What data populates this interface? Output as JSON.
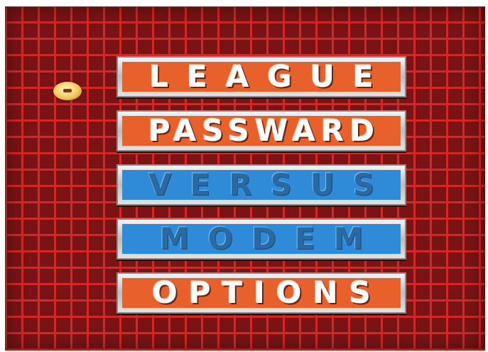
{
  "menu": {
    "items": [
      {
        "label": "LEAGUE",
        "state": "enabled",
        "color": "#e8602a"
      },
      {
        "label": "PASSWARD",
        "state": "enabled",
        "color": "#e8602a"
      },
      {
        "label": "VERSUS",
        "state": "disabled",
        "color": "#2f8ad8"
      },
      {
        "label": "MODEM",
        "state": "disabled",
        "color": "#2f8ad8"
      },
      {
        "label": "OPTIONS",
        "state": "enabled",
        "color": "#e8602a"
      }
    ],
    "selected_index": 0
  },
  "cursor": {
    "icon": "football-cursor-icon"
  },
  "background": {
    "pattern": "red-grid",
    "color": "#7a1414",
    "line_color": "#d42828"
  }
}
